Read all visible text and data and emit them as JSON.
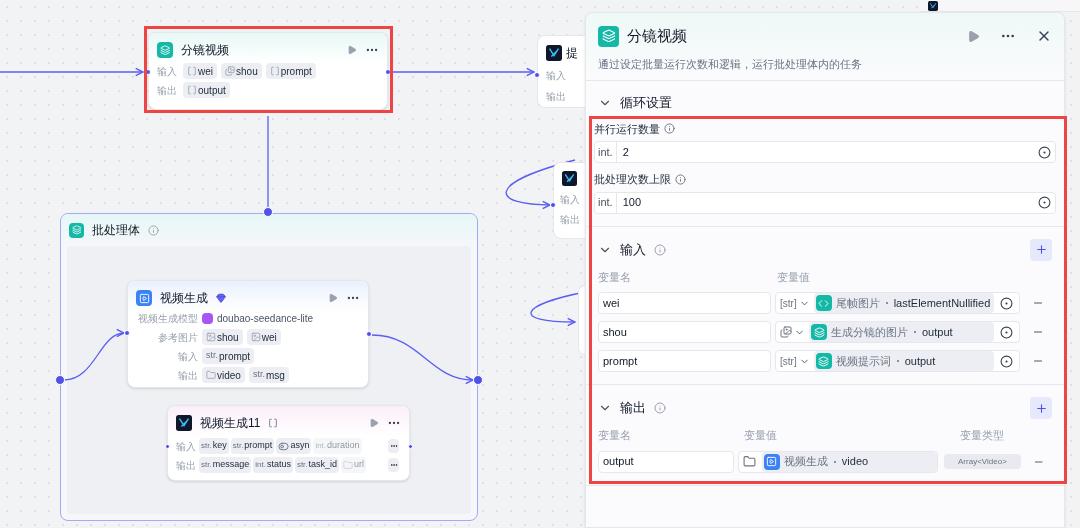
{
  "canvas": {
    "main_node": {
      "title": "分镜视频",
      "rows": [
        {
          "label": "输入",
          "tags": [
            {
              "kind": "array",
              "name": "wei"
            },
            {
              "kind": "image-array",
              "name": "shou"
            },
            {
              "kind": "array",
              "name": "prompt"
            }
          ]
        },
        {
          "label": "输出",
          "tags": [
            {
              "kind": "array",
              "name": "output"
            }
          ]
        }
      ]
    },
    "side_node": {
      "title": "提",
      "rows": [
        {
          "label": "输入"
        },
        {
          "label": "输出"
        }
      ]
    },
    "loop_node": {
      "rows": [
        {
          "label": "输入"
        },
        {
          "label": "输出"
        }
      ]
    },
    "batch": {
      "title": "批处理体",
      "video_node": {
        "title": "视频生成",
        "rows": [
          {
            "label": "视频生成模型",
            "tags": [
              {
                "kind": "model",
                "name": "doubao-seedance-lite"
              }
            ]
          },
          {
            "label": "参考图片",
            "tags": [
              {
                "kind": "image",
                "name": "shou"
              },
              {
                "kind": "image",
                "name": "wei"
              }
            ]
          },
          {
            "label": "输入",
            "tags": [
              {
                "kind": "text",
                "prefix": "str.",
                "name": "prompt"
              }
            ]
          },
          {
            "label": "输出",
            "tags": [
              {
                "kind": "file",
                "name": "video"
              },
              {
                "kind": "text",
                "prefix": "str.",
                "name": "msg"
              }
            ]
          }
        ]
      },
      "plugin_node": {
        "title": "视频生成11",
        "rows": [
          {
            "label": "输入",
            "tags": [
              {
                "kind": "text",
                "prefix": "str.",
                "name": "key",
                "faded": false
              },
              {
                "kind": "text",
                "prefix": "str.",
                "name": "prompt",
                "faded": false
              },
              {
                "kind": "toggle",
                "name": "asyn",
                "faded": false
              },
              {
                "kind": "text",
                "prefix": "int.",
                "name": "duration",
                "faded": true
              }
            ]
          },
          {
            "label": "输出",
            "tags": [
              {
                "kind": "text",
                "prefix": "str.",
                "name": "message",
                "faded": false
              },
              {
                "kind": "text",
                "prefix": "int.",
                "name": "status",
                "faded": false
              },
              {
                "kind": "text",
                "prefix": "str.",
                "name": "task_id",
                "faded": false
              },
              {
                "kind": "file",
                "name": "url",
                "faded": true
              }
            ]
          }
        ]
      }
    }
  },
  "panel": {
    "title": "分镜视频",
    "description": "通过设定批量运行次数和逻辑，运行批处理体内的任务",
    "loop_settings": {
      "title": "循环设置",
      "expanded": true,
      "fields": [
        {
          "label": "并行运行数量",
          "type": "int.",
          "value": "2"
        },
        {
          "label": "批处理次数上限",
          "type": "int.",
          "value": "100"
        }
      ]
    },
    "inputs": {
      "title": "输入",
      "expanded": true,
      "columns": [
        "变量名",
        "变量值"
      ],
      "rows": [
        {
          "name": "wei",
          "type": {
            "kind": "text",
            "label": "[str]"
          },
          "source": {
            "kind": "code",
            "node": "尾帧图片",
            "field": "lastElementNullified"
          }
        },
        {
          "name": "shou",
          "type": {
            "kind": "image-array"
          },
          "source": {
            "kind": "layers",
            "node": "生成分镜的图片",
            "field": "output"
          }
        },
        {
          "name": "prompt",
          "type": {
            "kind": "text",
            "label": "[str]"
          },
          "source": {
            "kind": "layers",
            "node": "视频提示词",
            "field": "output"
          }
        }
      ]
    },
    "outputs": {
      "title": "输出",
      "expanded": true,
      "columns": [
        "变量名",
        "变量值",
        "变量类型"
      ],
      "rows": [
        {
          "name": "output",
          "source": {
            "kind": "video",
            "node": "视频生成",
            "field": "video"
          },
          "value_type": "Array<Video>"
        }
      ]
    }
  }
}
